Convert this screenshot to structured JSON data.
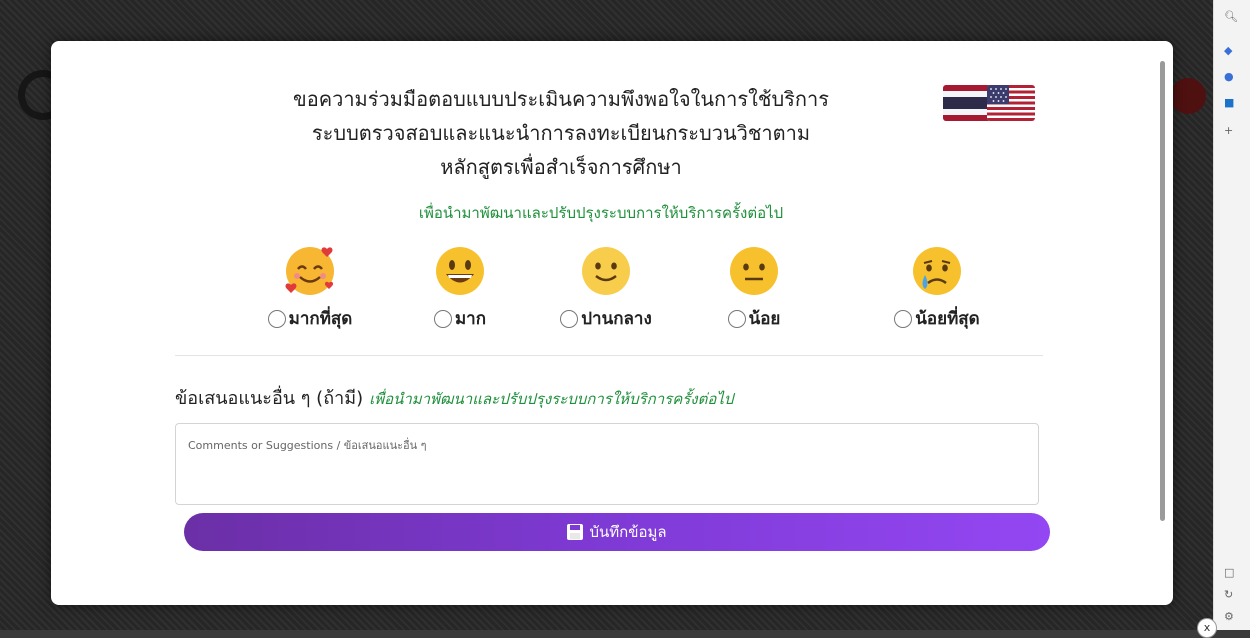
{
  "survey": {
    "title_lines": [
      "ขอความร่วมมือตอบแบบประเมินความพึงพอใจในการใช้บริการ",
      "ระบบตรวจสอบและแนะนำการลงทะเบียนกระบวนวิชาตาม",
      "หลักสูตรเพื่อสำเร็จการศึกษา"
    ],
    "subtitle": "เพื่อนำมาพัฒนาและปรับปรุงระบบการให้บริการครั้งต่อไป",
    "options": [
      {
        "label": "มากที่สุด",
        "icon": "heart-eyes-emoji-icon"
      },
      {
        "label": "มาก",
        "icon": "grinning-emoji-icon"
      },
      {
        "label": "ปานกลาง",
        "icon": "smiling-emoji-icon"
      },
      {
        "label": "น้อย",
        "icon": "neutral-emoji-icon"
      },
      {
        "label": "น้อยที่สุด",
        "icon": "crying-emoji-icon"
      }
    ],
    "suggestion_heading": "ข้อเสนอแนะอื่น ๆ (ถ้ามี)",
    "suggestion_note": "เพื่อนำมาพัฒนาและปรับปรุงระบบการให้บริการครั้งต่อไป",
    "textarea_placeholder": "Comments or Suggestions / ข้อเสนอแนะอื่น ๆ",
    "save_label": "บันทึกข้อมูล",
    "close_glyph": "x",
    "flag_languages": [
      "Thai",
      "English"
    ]
  },
  "colors": {
    "accent_green": "#1e8f3a",
    "button_gradient": [
      "#6b2fa6",
      "#9347f2"
    ]
  }
}
